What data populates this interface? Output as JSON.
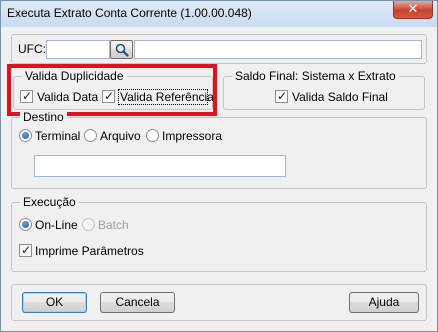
{
  "window": {
    "title": "Executa Extrato Conta Corrente (1.00.00.048)",
    "close_symbol": "✕"
  },
  "ufc": {
    "label": "UFC:",
    "code_value": "",
    "value": ""
  },
  "valida_duplicidade": {
    "legend": "Valida Duplicidade",
    "valida_data": {
      "label": "Valida Data",
      "checked": true
    },
    "valida_referencia": {
      "label": "Valida Referência",
      "checked": true
    }
  },
  "saldo_final": {
    "legend": "Saldo Final: Sistema x Extrato",
    "valida_saldo_final": {
      "label": "Valida Saldo Final",
      "checked": true
    }
  },
  "destino": {
    "legend": "Destino",
    "options": [
      "Terminal",
      "Arquivo",
      "Impressora"
    ],
    "selected": "Terminal",
    "path_value": ""
  },
  "execucao": {
    "legend": "Execução",
    "options": [
      "On-Line",
      "Batch"
    ],
    "selected": "On-Line",
    "imprime_parametros": {
      "label": "Imprime Parâmetros",
      "checked": true
    }
  },
  "buttons": {
    "ok": "OK",
    "cancela": "Cancela",
    "ajuda": "Ajuda"
  },
  "colors": {
    "highlight": "#e0101c",
    "title_bg": "#c8dbef",
    "close_btn": "#c7412d"
  },
  "check_mark": "✓"
}
